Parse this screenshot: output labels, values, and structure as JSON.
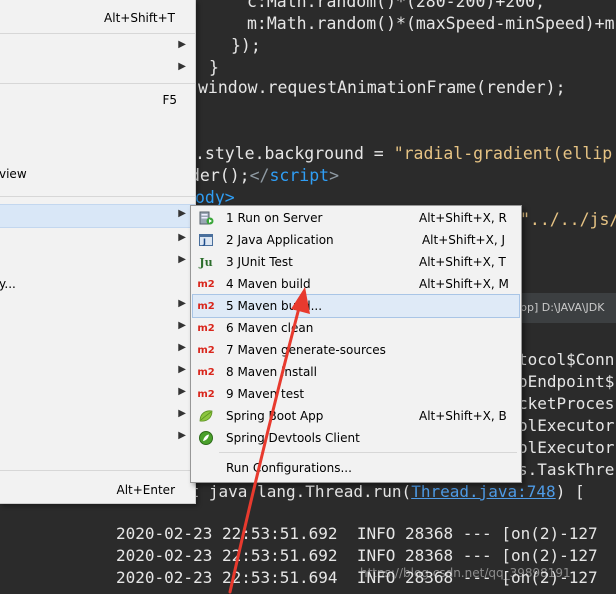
{
  "editor": {
    "lines": [
      "c:Math.random()*(280-200)+200,",
      "m:Math.random()*(maxSpeed-minSpeed)+m",
      "});",
      "}",
      "window.requestAnimationFrame(render);",
      ".style.background = ",
      "\"radial-gradient(ellip",
      "der();",
      "</",
      "script",
      ">",
      "ody>",
      "\"../../js/"
    ]
  },
  "console": {
    "header_text": "pp] D:\\JAVA\\JDK",
    "partial_lines": [
      "tocol$Conn",
      "oEndpoint$",
      "cketProces",
      "olExecutor",
      "olExecutor",
      "s.TaskThre"
    ],
    "run_line_prefix": "at java.lang.Thread.run(",
    "run_line_link": "Thread.java:748",
    "run_line_suffix": ") [",
    "log_lines": [
      "2020-02-23 22:53:51.692  INFO 28368 --- [on(2)-127",
      "2020-02-23 22:53:51.692  INFO 28368 --- [on(2)-127",
      "2020-02-23 22:53:51.694  INFO 28368 --- [on(2)-127"
    ],
    "watermark": "https://blog.csdn.net/qq_39898191"
  },
  "context_menu": {
    "items": [
      {
        "label": "",
        "shortcut": "Alt+Shift+T",
        "arrow": "▶"
      },
      {
        "label": "",
        "shortcut": "",
        "arrow": "▶"
      },
      {
        "label": "",
        "shortcut": "",
        "arrow": "▶"
      },
      {
        "label": "",
        "shortcut": "F5",
        "arrow": ""
      },
      {
        "label": "view",
        "shortcut": "",
        "arrow": ""
      },
      {
        "label": "",
        "shortcut": "",
        "arrow": "▶"
      },
      {
        "label": "",
        "shortcut": "",
        "arrow": "▶"
      },
      {
        "label": "",
        "shortcut": "",
        "arrow": "▶"
      },
      {
        "label": "y...",
        "shortcut": "",
        "arrow": ""
      },
      {
        "label": "",
        "shortcut": "",
        "arrow": "▶"
      },
      {
        "label": "",
        "shortcut": "",
        "arrow": "▶"
      },
      {
        "label": "",
        "shortcut": "",
        "arrow": "▶"
      },
      {
        "label": "",
        "shortcut": "",
        "arrow": "▶"
      },
      {
        "label": "",
        "shortcut": "",
        "arrow": "▶"
      },
      {
        "label": "",
        "shortcut": "",
        "arrow": "▶"
      },
      {
        "label": "",
        "shortcut": "",
        "arrow": "▶"
      },
      {
        "label": "",
        "shortcut": "Alt+Enter",
        "arrow": ""
      }
    ]
  },
  "run_as_menu": {
    "items": [
      {
        "label": "1 Run on Server",
        "shortcut": "Alt+Shift+X, R",
        "icon": "server-run-icon"
      },
      {
        "label": "2 Java Application",
        "shortcut": "Alt+Shift+X, J",
        "icon": "java-app-icon"
      },
      {
        "label": "3 JUnit Test",
        "shortcut": "Alt+Shift+X, T",
        "icon": "junit-icon",
        "icon_text": "Ju"
      },
      {
        "label": "4 Maven build",
        "shortcut": "Alt+Shift+X, M",
        "icon": "maven-icon",
        "icon_text": "m2"
      },
      {
        "label": "5 Maven build...",
        "shortcut": "",
        "icon": "maven-icon",
        "icon_text": "m2"
      },
      {
        "label": "6 Maven clean",
        "shortcut": "",
        "icon": "maven-icon",
        "icon_text": "m2"
      },
      {
        "label": "7 Maven generate-sources",
        "shortcut": "",
        "icon": "maven-icon",
        "icon_text": "m2"
      },
      {
        "label": "8 Maven install",
        "shortcut": "",
        "icon": "maven-icon",
        "icon_text": "m2"
      },
      {
        "label": "9 Maven test",
        "shortcut": "",
        "icon": "maven-icon",
        "icon_text": "m2"
      },
      {
        "label": "Spring Boot App",
        "shortcut": "Alt+Shift+X, B",
        "icon": "spring-boot-icon"
      },
      {
        "label": "Spring Devtools Client",
        "shortcut": "",
        "icon": "spring-devtools-icon"
      },
      {
        "label": "Run Configurations...",
        "shortcut": "",
        "icon": ""
      }
    ]
  },
  "colors": {
    "editor_bg": "#2b2b2b",
    "menu_bg": "#f2f2f2",
    "highlight": "#dfeaf7",
    "maven_red": "#d9261c",
    "annotation_arrow": "#e83a2e"
  }
}
